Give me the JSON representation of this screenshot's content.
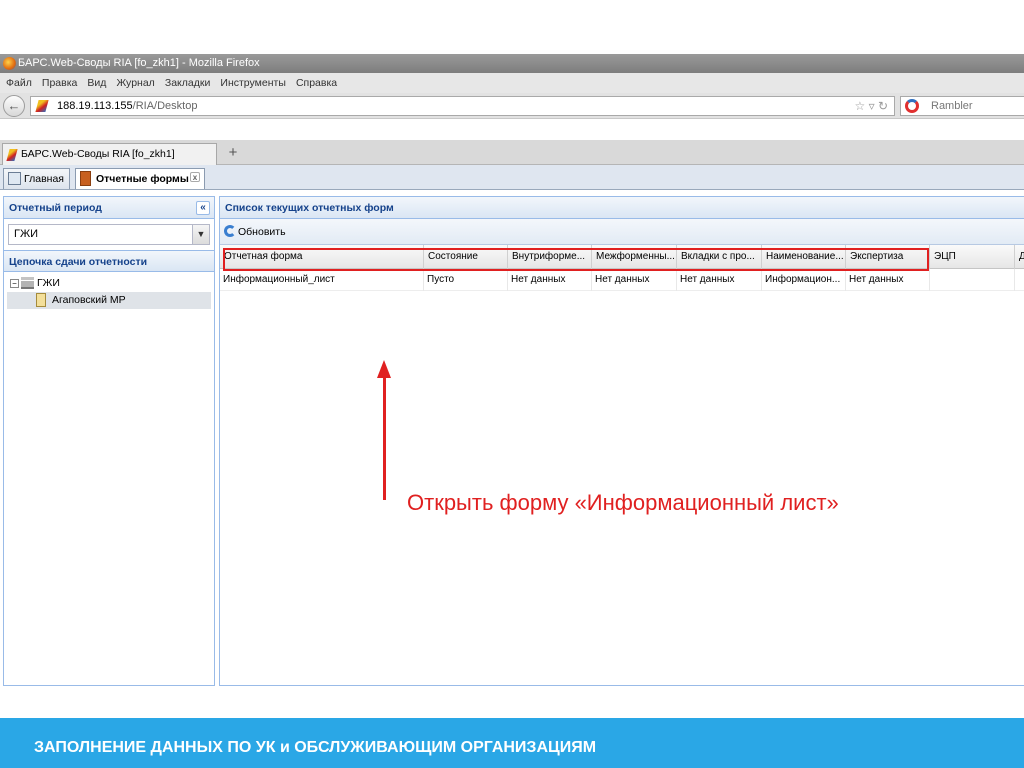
{
  "window": {
    "title": "БАРС.Web-Своды RIA [fo_zkh1] - Mozilla Firefox"
  },
  "menu": [
    "Файл",
    "Правка",
    "Вид",
    "Журнал",
    "Закладки",
    "Инструменты",
    "Справка"
  ],
  "address": {
    "host": "188.19.113.155",
    "path": "/RIA/Desktop"
  },
  "search": {
    "placeholder": "Rambler"
  },
  "browser_tab": {
    "label": "БАРС.Web-Своды RIA [fo_zkh1]",
    "new_tab": "+"
  },
  "app_tabs": {
    "home": "Главная",
    "forms": "Отчетные формы"
  },
  "left": {
    "period_title": "Отчетный период",
    "period_value": "ГЖИ",
    "chain_title": "Цепочка сдачи отчетности",
    "tree": [
      {
        "label": "ГЖИ"
      },
      {
        "label": "Агаповский МР"
      }
    ]
  },
  "right": {
    "title": "Список текущих отчетных форм",
    "refresh": "Обновить",
    "columns": [
      "Отчетная форма",
      "Состояние",
      "Внутриформе...",
      "Межформенны...",
      "Вкладки с про...",
      "Наименование...",
      "Экспертиза",
      "ЭЦП",
      "Д"
    ],
    "rows": [
      [
        "Информационный_лист",
        "Пусто",
        "Нет данных",
        "Нет данных",
        "Нет данных",
        "Информацион...",
        "Нет данных",
        "",
        ""
      ]
    ]
  },
  "annotation": {
    "text": "Открыть форму «Информационный лист»"
  },
  "footer": {
    "text": "ЗАПОЛНЕНИЕ ДАННЫХ ПО УК и ОБСЛУЖИВАЮЩИМ ОРГАНИЗАЦИЯМ"
  },
  "colors": {
    "annotation": "#e02020",
    "footer_bg": "#2aa7e6",
    "panel_border": "#99bbe8"
  }
}
